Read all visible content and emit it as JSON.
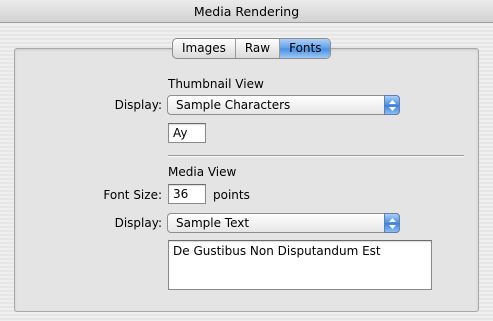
{
  "window": {
    "title": "Media Rendering"
  },
  "tabs": [
    {
      "label": "Images",
      "selected": false
    },
    {
      "label": "Raw",
      "selected": false
    },
    {
      "label": "Fonts",
      "selected": true
    }
  ],
  "thumbnail": {
    "heading": "Thumbnail View",
    "display_label": "Display:",
    "display_value": "Sample Characters",
    "sample_value": "Ay"
  },
  "media": {
    "heading": "Media View",
    "font_size_label": "Font Size:",
    "font_size_value": "36",
    "font_size_unit": "points",
    "display_label": "Display:",
    "display_value": "Sample Text",
    "sample_text": "De Gustibus Non Disputandum Est"
  },
  "colors": {
    "selected_tab": "#5d9fea",
    "popup_arrow": "#4b8fe4"
  }
}
